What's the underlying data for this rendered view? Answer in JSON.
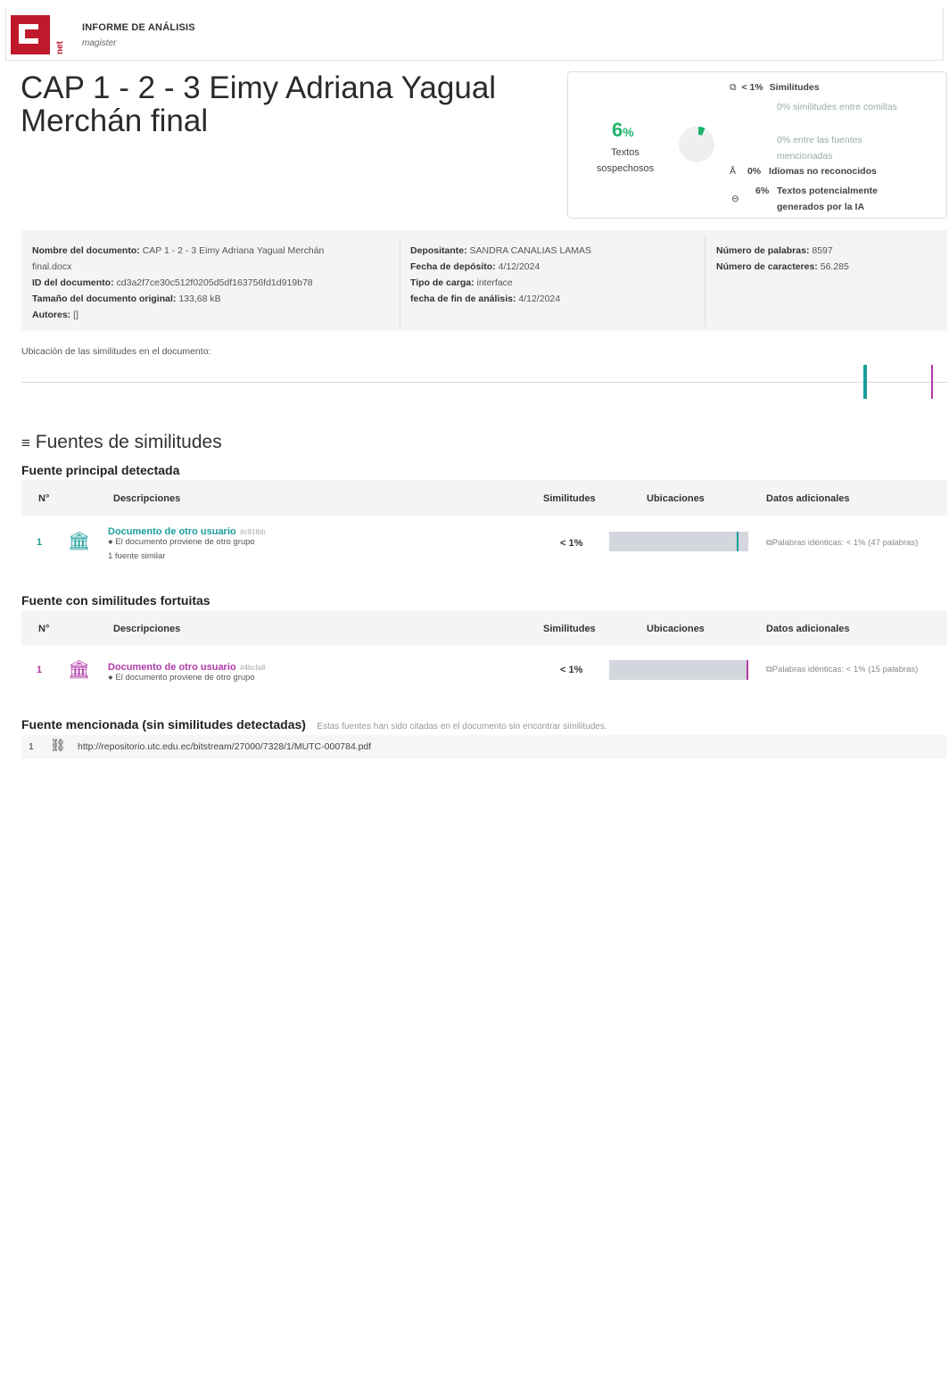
{
  "header": {
    "brand_letters": "net",
    "title": "INFORME DE ANÁLISIS",
    "subtitle": "magister"
  },
  "document_title": "CAP 1 - 2 - 3 Eimy Adriana Yagual Merchán final",
  "summary": {
    "main_pct": "6",
    "pct_sign": "%",
    "main_label_1": "Textos",
    "main_label_2": "sospechosos",
    "similitudes_val": "< 1%",
    "similitudes_lbl": "Similitudes",
    "comillas": "0% similitudes entre comillas",
    "fuentes_mencionadas": "0% entre las fuentes mencionadas",
    "idiomas_val": "0%",
    "idiomas_lbl": "Idiomas no reconocidos",
    "ia_val": "6%",
    "ia_lbl_1": "Textos potencialmente",
    "ia_lbl_2": "generados por la IA",
    "colors": {
      "accent": "#1fb36b"
    }
  },
  "meta": {
    "nombre_lbl": "Nombre del documento:",
    "nombre_val": "CAP 1 - 2 - 3 Eimy Adriana Yagual Merchán",
    "nombre_val2": "final.docx",
    "id_lbl": "ID del documento:",
    "id_val": "cd3a2f7ce30c512f0205d5df163756fd1d919b78",
    "tam_lbl": "Tamaño del documento original:",
    "tam_val": "133,68 kB",
    "autores_lbl": "Autores:",
    "autores_val": "[]",
    "dep_lbl": "Depositante:",
    "dep_val": "SANDRA CANALIAS LAMAS",
    "fecha_dep_lbl": "Fecha de depósito:",
    "fecha_dep_val": "4/12/2024",
    "tipo_lbl": "Tipo de carga:",
    "tipo_val": "interface",
    "fin_lbl": "fecha de fin de análisis:",
    "fin_val": "4/12/2024",
    "palabras_lbl": "Número de palabras:",
    "palabras_val": "8597",
    "caracteres_lbl": "Número de caracteres:",
    "caracteres_val": "56.285"
  },
  "ubicacion_label": "Ubicación de las similitudes en el documento:",
  "fuentes_title": "Fuentes de similitudes",
  "columns": {
    "num": "N°",
    "desc": "Descripciones",
    "sim": "Similitudes",
    "ubic": "Ubicaciones",
    "datos": "Datos adicionales"
  },
  "principal": {
    "title": "Fuente principal detectada",
    "row": {
      "num": "1",
      "name": "Documento de otro usuario",
      "hash": "#c91fbb",
      "origin": "El documento proviene de otro grupo",
      "extra": "1 fuente similar",
      "sim": "< 1%",
      "datos": "Palabras idénticas: < 1% (47 palabras)"
    }
  },
  "fortuitas": {
    "title": "Fuente con similitudes fortuitas",
    "row": {
      "num": "1",
      "name": "Documento de otro usuario",
      "hash": "#4bcfa8",
      "origin": "El documento proviene de otro grupo",
      "sim": "< 1%",
      "datos": "Palabras idénticas: < 1% (15 palabras)"
    }
  },
  "mencionada": {
    "title": "Fuente mencionada (sin similitudes detectadas)",
    "note": "Estas fuentes han sido citadas en el documento sin encontrar similitudes.",
    "num": "1",
    "url": "http://repositorio.utc.edu.ec/bitstream/27000/7328/1/MUTC-000784.pdf"
  }
}
